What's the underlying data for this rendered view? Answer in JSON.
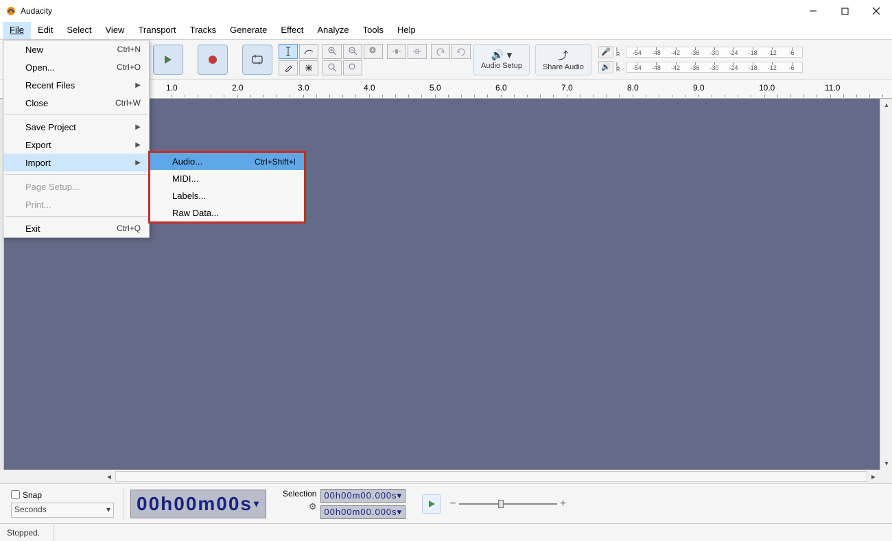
{
  "window": {
    "title": "Audacity"
  },
  "menubar": {
    "file": "File",
    "edit": "Edit",
    "select": "Select",
    "view": "View",
    "transport": "Transport",
    "tracks": "Tracks",
    "generate": "Generate",
    "effect": "Effect",
    "analyze": "Analyze",
    "tools": "Tools",
    "help": "Help"
  },
  "file_menu": {
    "new": {
      "label": "New",
      "shortcut": "Ctrl+N"
    },
    "open": {
      "label": "Open...",
      "shortcut": "Ctrl+O"
    },
    "recent": {
      "label": "Recent Files"
    },
    "close": {
      "label": "Close",
      "shortcut": "Ctrl+W"
    },
    "save": {
      "label": "Save Project"
    },
    "export": {
      "label": "Export"
    },
    "import": {
      "label": "Import"
    },
    "page_setup": {
      "label": "Page Setup..."
    },
    "print": {
      "label": "Print..."
    },
    "exit": {
      "label": "Exit",
      "shortcut": "Ctrl+Q"
    }
  },
  "import_menu": {
    "audio": {
      "label": "Audio...",
      "shortcut": "Ctrl+Shift+I"
    },
    "midi": {
      "label": "MIDI..."
    },
    "labels": {
      "label": "Labels..."
    },
    "raw": {
      "label": "Raw Data..."
    }
  },
  "toolbar": {
    "audio_setup": "Audio Setup",
    "share_audio": "Share Audio"
  },
  "meter_ticks": [
    "-54",
    "-48",
    "-42",
    "-36",
    "-30",
    "-24",
    "-18",
    "-12",
    "-6"
  ],
  "ruler_ticks": [
    "1.0",
    "2.0",
    "3.0",
    "4.0",
    "5.0",
    "6.0",
    "7.0",
    "8.0",
    "9.0",
    "10.0",
    "11.0"
  ],
  "snap": {
    "label": "Snap",
    "unit": "Seconds"
  },
  "time_main": "00h00m00s",
  "selection": {
    "label": "Selection",
    "start": "00h00m00.000s",
    "end": "00h00m00.000s"
  },
  "status": {
    "state": "Stopped."
  }
}
